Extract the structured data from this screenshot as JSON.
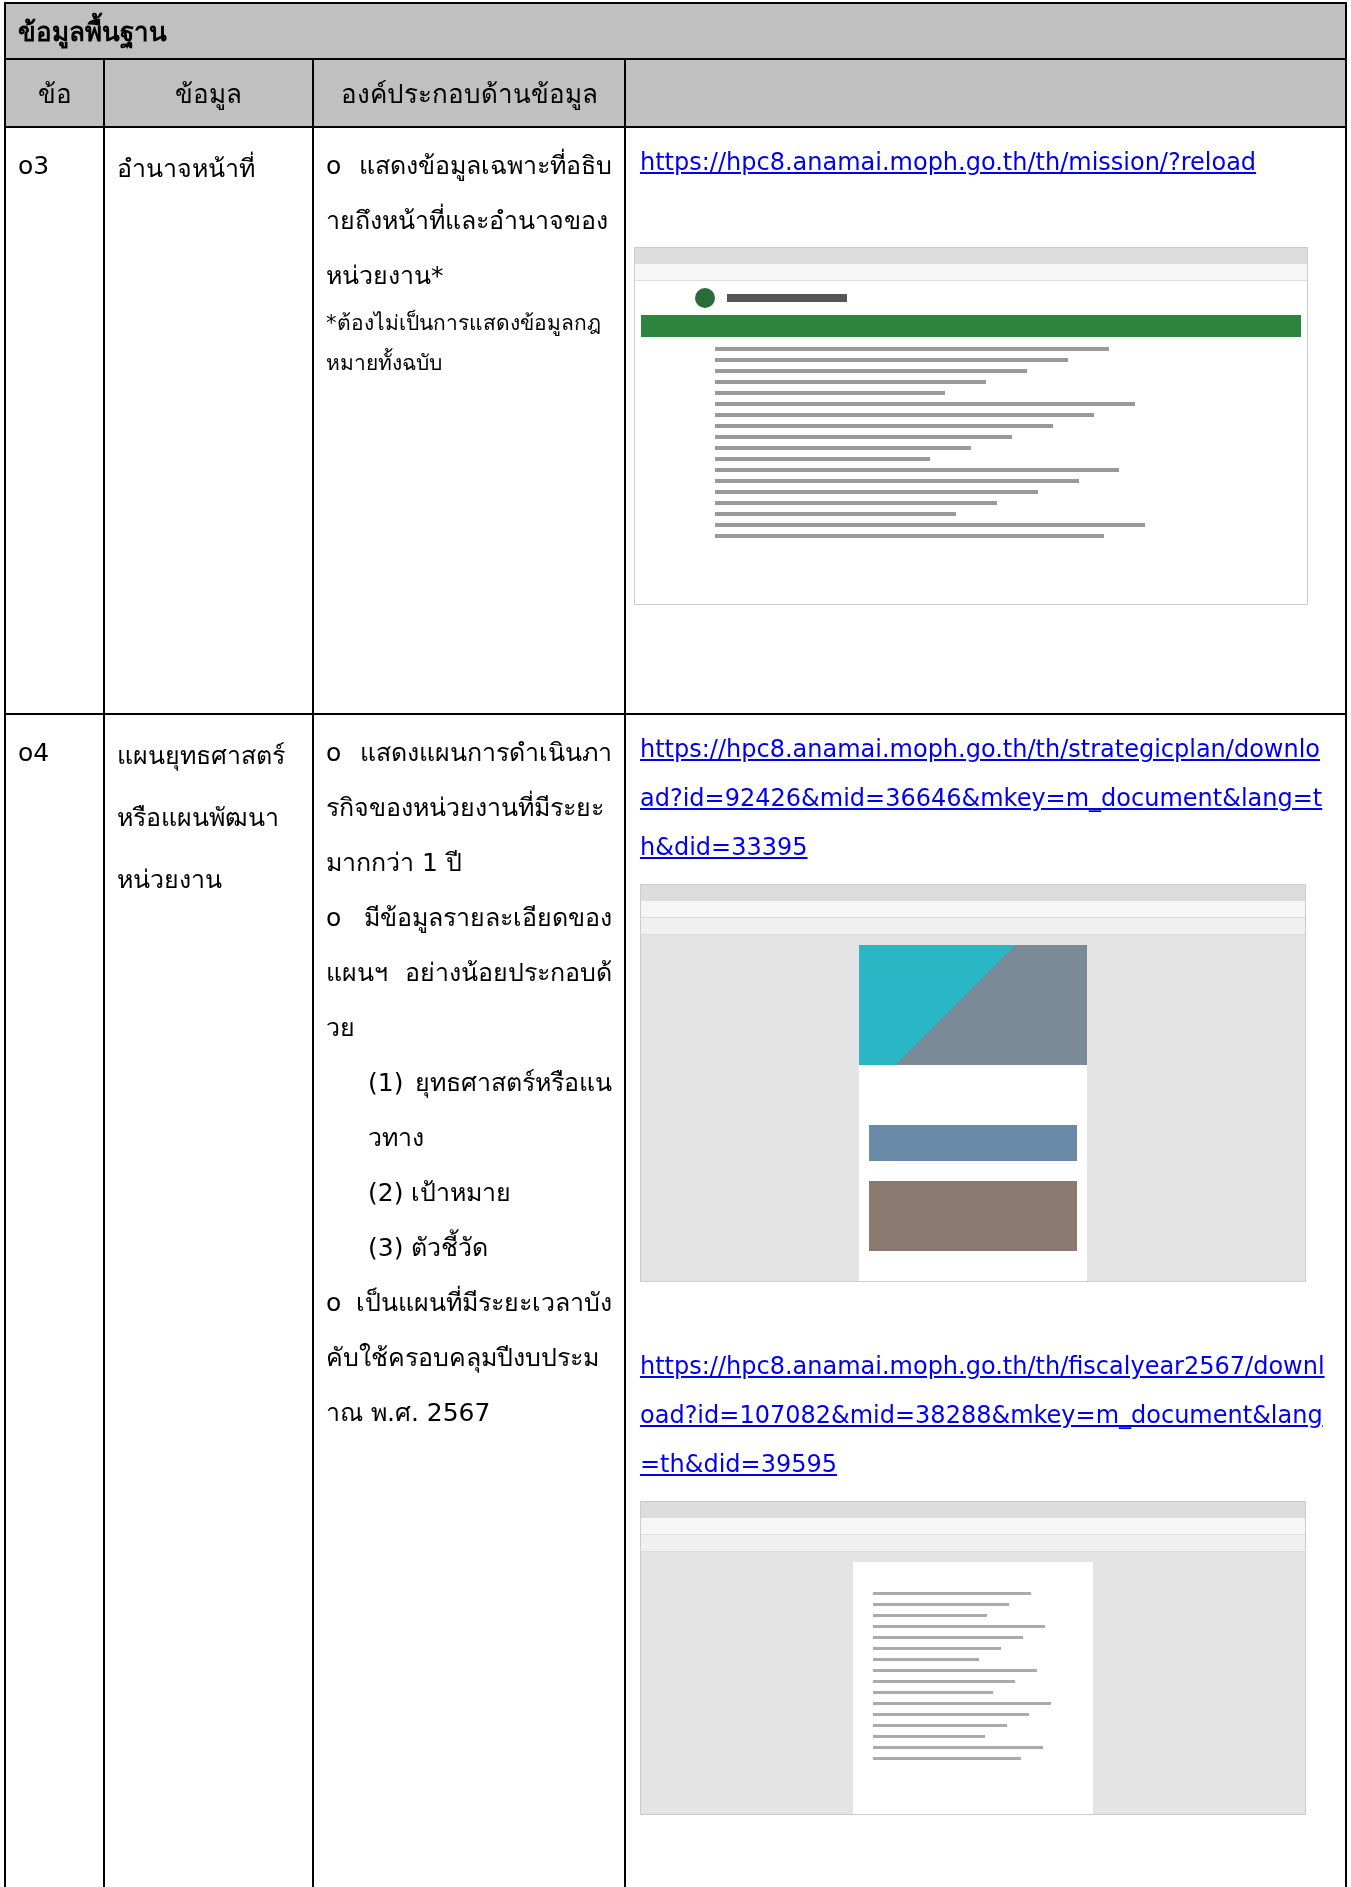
{
  "title": "ข้อมูลพื้นฐาน",
  "columns": [
    "ข้อ",
    "ข้อมูล",
    "องค์ประกอบด้านข้อมูล"
  ],
  "rows": [
    {
      "no": "o3",
      "topic": "อำนาจหน้าที่",
      "criteria": [
        {
          "kind": "bullet",
          "text": "o แสดงข้อมูลเฉพาะที่อธิบายถึงหน้าที่และอำนาจของหน่วยงาน*"
        },
        {
          "kind": "note",
          "text": "*ต้องไม่เป็นการแสดงข้อมูลกฎหมายทั้งฉบับ"
        }
      ],
      "evidence": [
        {
          "url": "https://hpc8.anamai.moph.go.th/th/mission/?reload",
          "kind": "webpage"
        }
      ]
    },
    {
      "no": "o4",
      "topic": "แผนยุทธศาสตร์หรือแผนพัฒนาหน่วยงาน",
      "criteria": [
        {
          "kind": "bullet",
          "text": "o แสดงแผนการดำเนินภารกิจของหน่วยงานที่มีระยะมากกว่า 1 ปี"
        },
        {
          "kind": "bullet",
          "text": "o มีข้อมูลรายละเอียดของแผนฯ อย่างน้อยประกอบด้วย"
        },
        {
          "kind": "sub",
          "text": "(1) ยุทธศาสตร์หรือแนวทาง"
        },
        {
          "kind": "sub",
          "text": "(2) เป้าหมาย"
        },
        {
          "kind": "sub",
          "text": "(3) ตัวชี้วัด"
        },
        {
          "kind": "bullet",
          "text": "o เป็นแผนที่มีระยะเวลาบังคับใช้ครอบคลุมปีงบประมาณ พ.ศ. 2567"
        }
      ],
      "evidence": [
        {
          "url": "https://hpc8.anamai.moph.go.th/th/strategicplan/download?id=92426&mid=36646&mkey=m_document&lang=th&did=33395",
          "kind": "pdf-poster"
        },
        {
          "url": "https://hpc8.anamai.moph.go.th/th/fiscalyear2567/download?id=107082&mid=38288&mkey=m_document&lang=th&did=39595",
          "kind": "pdf-memo"
        }
      ]
    }
  ]
}
